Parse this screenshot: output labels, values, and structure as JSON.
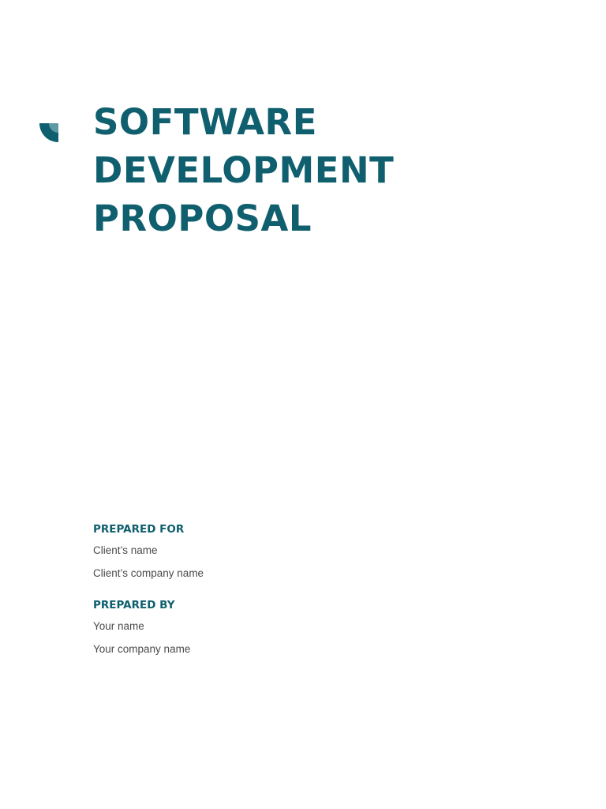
{
  "colors": {
    "accent": "#0f5f6e",
    "accent_light": "#5e9aa3",
    "body_text": "#4a4a4a",
    "background": "#ffffff"
  },
  "decoration": {
    "corner_icon": "quarter-circle-icon"
  },
  "title": {
    "lines": [
      "SOFTWARE",
      "DEVELOPMENT",
      "PROPOSAL"
    ]
  },
  "prepared_for": {
    "heading": "PREPARED FOR",
    "name": "Client’s name",
    "company": "Client’s company name"
  },
  "prepared_by": {
    "heading": "PREPARED BY",
    "name": "Your name",
    "company": "Your company name"
  }
}
